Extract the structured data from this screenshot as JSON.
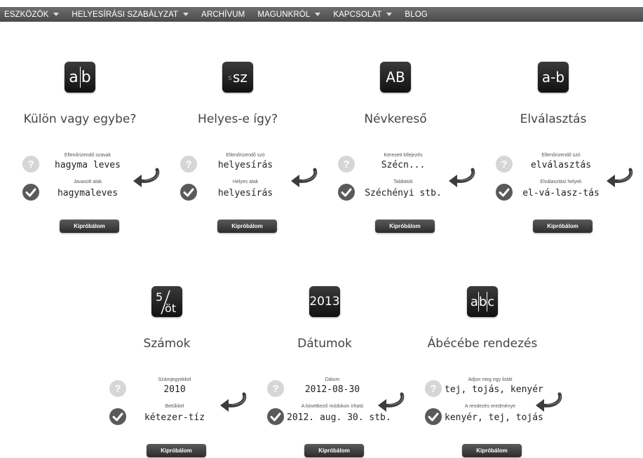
{
  "nav": {
    "items": [
      {
        "label": "ESZKÖZÖK",
        "dropdown": true
      },
      {
        "label": "HELYESÍRÁSI SZABÁLYZAT",
        "dropdown": true
      },
      {
        "label": "ARCHÍVUM",
        "dropdown": false
      },
      {
        "label": "MAGUNKRÓL",
        "dropdown": true
      },
      {
        "label": "KAPCSOLAT",
        "dropdown": true
      },
      {
        "label": "BLOG",
        "dropdown": false
      }
    ]
  },
  "button_label": "Kipróbálom",
  "tools": [
    {
      "icon_text": "ab",
      "icon": "ab-split-icon",
      "title": "Külön vagy egybe?",
      "label1": "Ellenőrizendő szavak",
      "value1": "hagyma leves",
      "label2": "Javasolt alak",
      "value2": "hagymaleves"
    },
    {
      "icon_text": "ssz",
      "icon": "ssz-icon",
      "title": "Helyes-e így?",
      "label1": "Ellenőrizendő szó",
      "value1": "helyesírás",
      "label2": "Helyes alak",
      "value2": "helyesírás"
    },
    {
      "icon_text": "AB",
      "icon": "ab-uppercase-icon",
      "title": "Névkereső",
      "label1": "Keresett kifejezés",
      "value1": "Szécn...",
      "label2": "Találatok",
      "value2": "Széchényi stb."
    },
    {
      "icon_text": "a-b",
      "icon": "hyphen-icon",
      "title": "Elválasztás",
      "label1": "Ellenőrizendő szó",
      "value1": "elválasztás",
      "label2": "Elválasztási helyek",
      "value2": "el-vá-lasz-tás"
    },
    {
      "icon_text": "5/öt",
      "icon": "fraction-icon",
      "title": "Számok",
      "label1": "Számjegyekkel",
      "value1": "2010",
      "label2": "Betűkkel",
      "value2": "kétezer-tíz"
    },
    {
      "icon_text": "2013",
      "icon": "year-icon",
      "title": "Dátumok",
      "label1": "Dátum",
      "value1": "2012-08-30",
      "label2": "A következő módokon írható",
      "value2": "2012. aug. 30. stb."
    },
    {
      "icon_text": "abc",
      "icon": "abc-icon",
      "title": "Ábécébe rendezés",
      "label1": "Adjon meg egy listát",
      "value1": "tej, tojás, kenyér",
      "label2": "A rendezés eredménye",
      "value2": "kenyér, tej, tojás"
    }
  ]
}
